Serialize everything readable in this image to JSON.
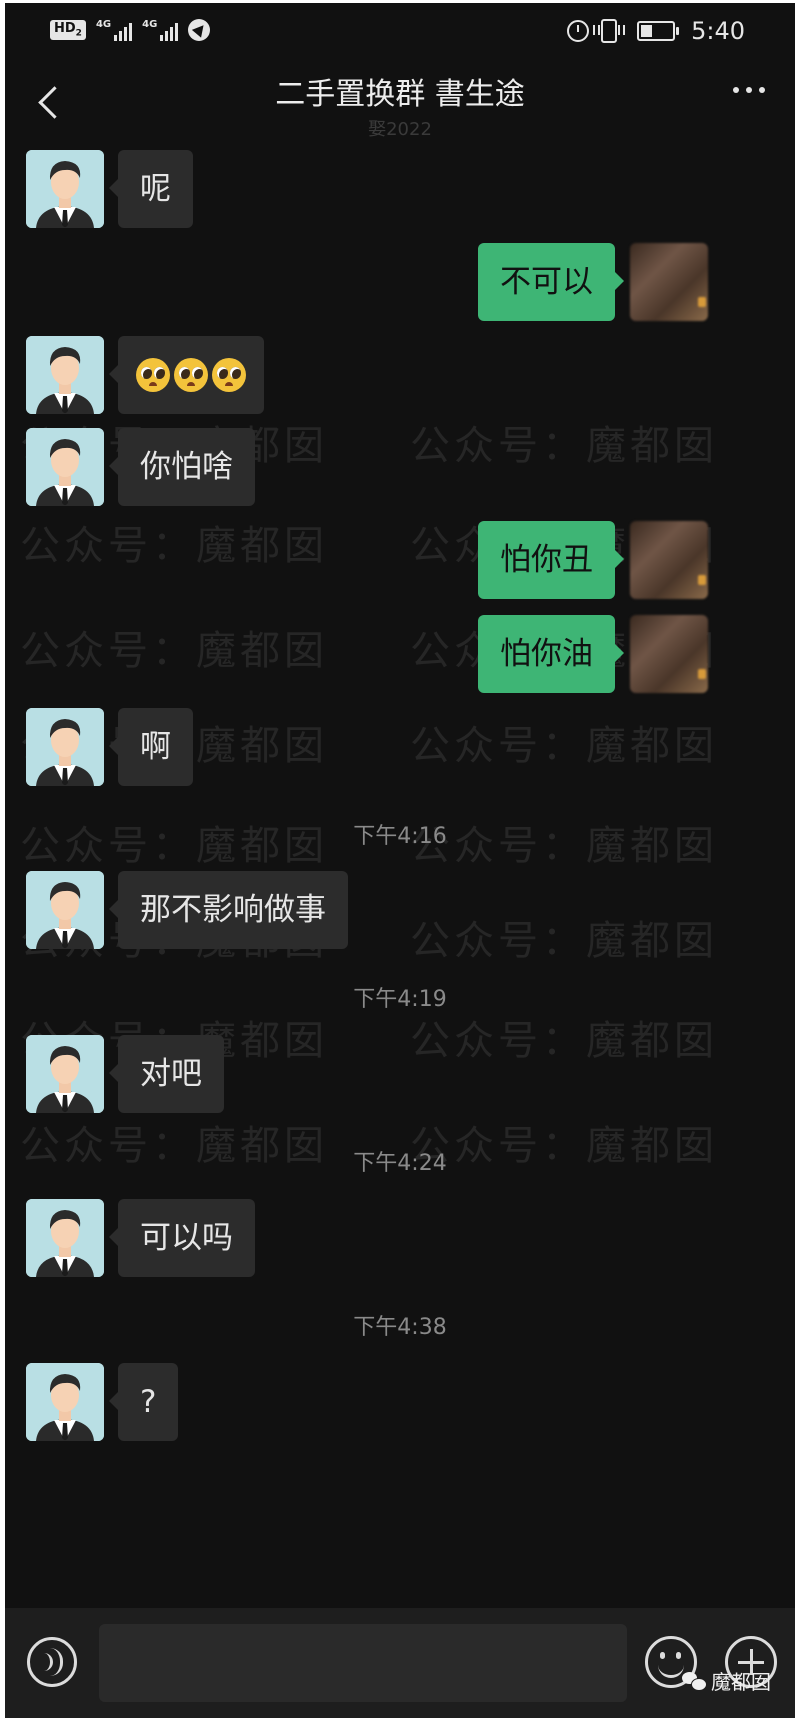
{
  "status_bar": {
    "network_badge": "HD",
    "network_badge_sub": "2",
    "signal1_label": "4G",
    "signal2_label": "4G",
    "time": "5:40"
  },
  "header": {
    "title": "二手置换群  書生途",
    "subtitle": "娶2022"
  },
  "watermark": "公众号：魔都囡",
  "messages": [
    {
      "side": "in",
      "text": "呢"
    },
    {
      "side": "out",
      "text": "不可以"
    },
    {
      "side": "in",
      "emoji": [
        "pleading-face",
        "pleading-face",
        "pleading-face"
      ]
    },
    {
      "side": "in",
      "text": "你怕啥"
    },
    {
      "side": "out",
      "text": "怕你丑"
    },
    {
      "side": "out",
      "text": "怕你油"
    },
    {
      "side": "in",
      "text": "啊"
    },
    {
      "time": "下午4:16"
    },
    {
      "side": "in",
      "text": "那不影响做事"
    },
    {
      "time": "下午4:19"
    },
    {
      "side": "in",
      "text": "对吧"
    },
    {
      "time": "下午4:24"
    },
    {
      "side": "in",
      "text": "可以吗"
    },
    {
      "time": "下午4:38"
    },
    {
      "side": "in",
      "text": "?"
    }
  ],
  "input_bar": {
    "text_value": "",
    "brand_label": "魔都囡"
  },
  "colors": {
    "background": "#111111",
    "incoming_bubble": "#2c2c2c",
    "outgoing_bubble": "#3eb575",
    "timestamp": "#8a8a8a"
  }
}
